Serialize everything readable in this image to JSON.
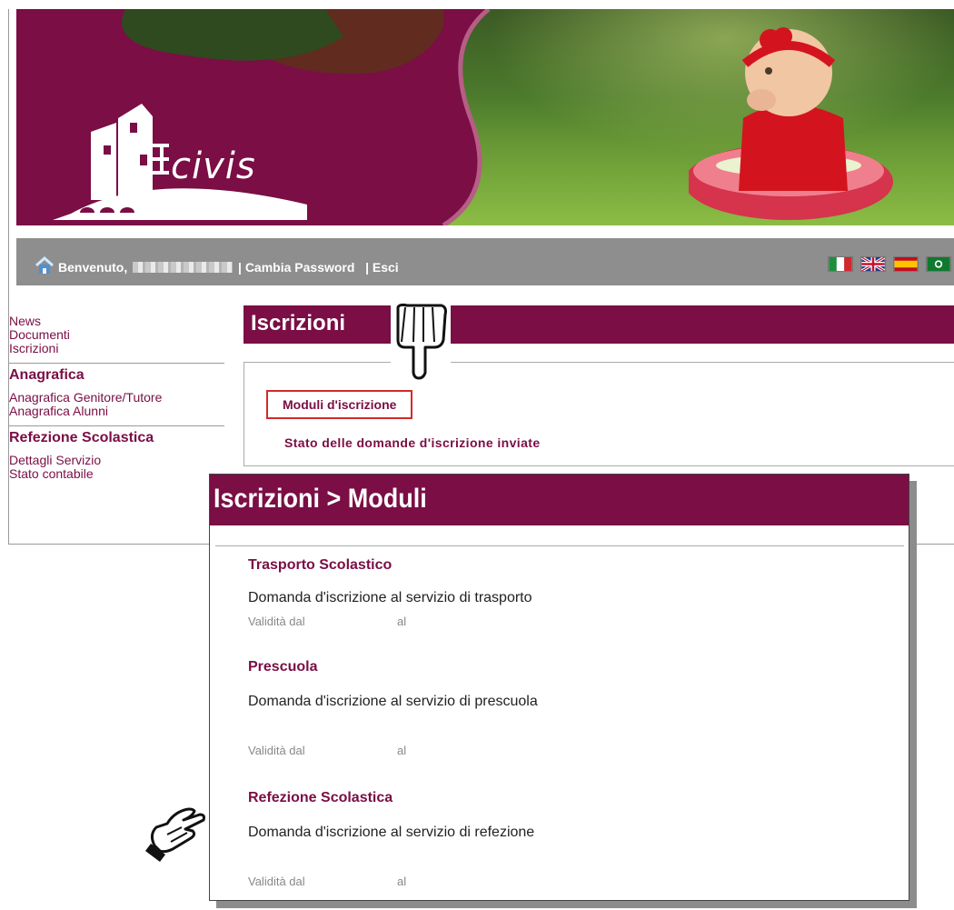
{
  "header": {
    "logo_text": "civis",
    "welcome_prefix": "Benvenuto,",
    "change_password": "| Cambia Password",
    "logout": "| Esci"
  },
  "sidebar": {
    "top_links": [
      "News",
      "Documenti",
      "Iscrizioni"
    ],
    "sections": [
      {
        "title": "Anagrafica",
        "items": [
          "Anagrafica Genitore/Tutore",
          "Anagrafica Alunni"
        ]
      },
      {
        "title": "Refezione Scolastica",
        "items": [
          "Dettagli Servizio",
          "Stato contabile"
        ]
      }
    ]
  },
  "main": {
    "title": "Iscrizioni",
    "links": [
      "Moduli d'iscrizione",
      "Stato delle domande d'iscrizione inviate"
    ]
  },
  "popup": {
    "title": "Iscrizioni > Moduli",
    "sections": [
      {
        "title": "Trasporto Scolastico",
        "desc": "Domanda d'iscrizione al servizio di trasporto",
        "valid_from": "Validità dal",
        "valid_to": "al"
      },
      {
        "title": "Prescuola",
        "desc": "Domanda d'iscrizione al servizio di prescuola",
        "valid_from": "Validità dal",
        "valid_to": "al"
      },
      {
        "title": "Refezione Scolastica",
        "desc": "Domanda d'iscrizione al servizio di refezione",
        "valid_from": "Validità dal",
        "valid_to": "al"
      }
    ]
  },
  "colors": {
    "brand": "#7a0e45",
    "highlight": "#d32a2a",
    "bar": "#8e8e8e"
  },
  "icons": [
    "home-icon",
    "flag-it-icon",
    "flag-uk-icon",
    "flag-es-icon",
    "flag-other-icon",
    "pointing-hand-icon"
  ]
}
